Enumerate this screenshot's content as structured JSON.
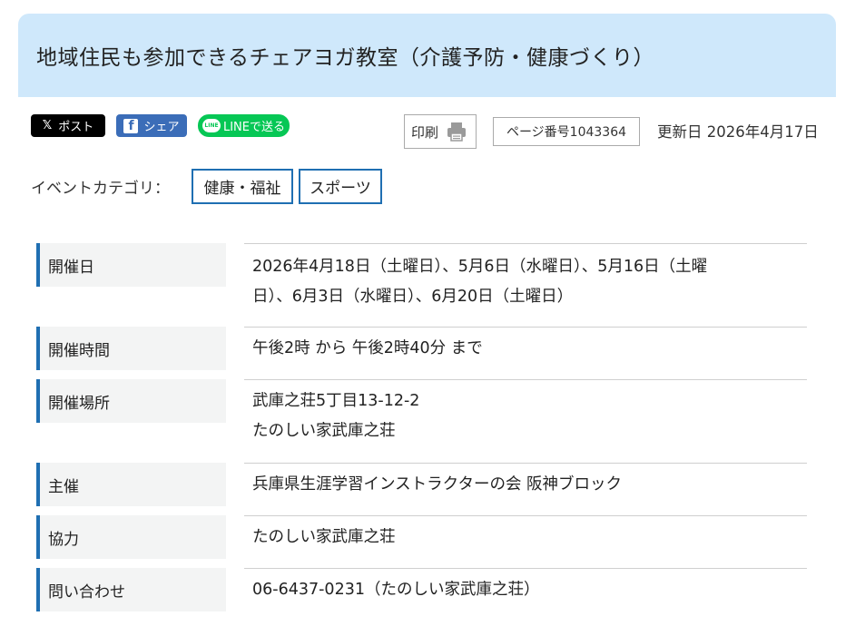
{
  "title": "地域住民も参加できるチェアヨガ教室（介護予防・健康づくり）",
  "share": {
    "x_label": "ポスト",
    "facebook_label": "シェア",
    "line_label": "LINEで送る",
    "line_logo": "LINE"
  },
  "print_label": "印刷",
  "page_number": "ページ番号1043364",
  "updated": "更新日 2026年4月17日",
  "category": {
    "label": "イベントカテゴリ：",
    "tags": [
      "健康・福祉",
      "スポーツ"
    ]
  },
  "details": {
    "date_label": "開催日",
    "date_value_1": "2026年4月18日（土曜日）、5月6日（水曜日）、5月16日（土曜",
    "date_value_2": "日）、6月3日（水曜日）、6月20日（土曜日）",
    "time_label": "開催時間",
    "time_value": "午後2時 から 午後2時40分 まで",
    "place_label": "開催場所",
    "place_value_1": "武庫之荘5丁目13-12-2",
    "place_value_2": "たのしい家武庫之荘",
    "host_label": "主催",
    "host_value": "兵庫県生涯学習インストラクターの会 阪神ブロック",
    "coop_label": "協力",
    "coop_value": "たのしい家武庫之荘",
    "contact_label": "問い合わせ",
    "contact_value": "06-6437-0231（たのしい家武庫之荘）"
  },
  "colors": {
    "title_bg": "#cfe8fb",
    "accent": "#1f6fb2",
    "facebook": "#3b6db8",
    "line": "#06c755",
    "x": "#000000"
  },
  "icons": [
    "x-logo-icon",
    "facebook-logo-icon",
    "line-logo-icon",
    "printer-icon"
  ]
}
